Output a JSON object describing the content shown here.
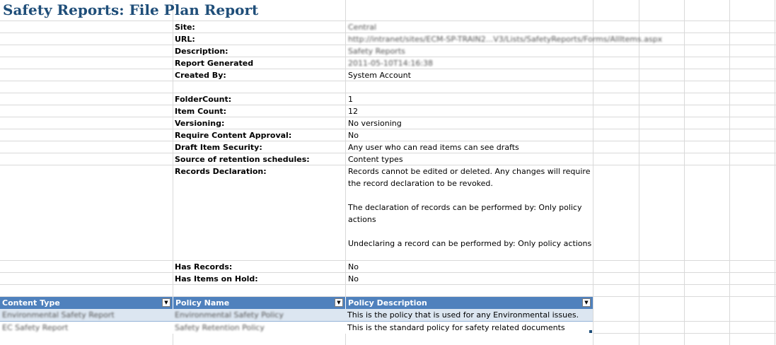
{
  "title": "Safety Reports: File Plan Report",
  "meta": [
    {
      "label": "Site:",
      "value": "Central",
      "redacted": true
    },
    {
      "label": "URL:",
      "value": "http://intranet/sites/ECM-SP-TRAIN2...V3/Lists/SafetyReports/Forms/AllItems.aspx",
      "redacted": true
    },
    {
      "label": "Description:",
      "value": "Safety Reports",
      "redacted": true
    },
    {
      "label": "Report Generated",
      "value": "2011-05-10T14:16:38",
      "redacted": true
    },
    {
      "label": "Created By:",
      "value": "System Account",
      "redacted": false
    }
  ],
  "settings": [
    {
      "label": "FolderCount:",
      "value": "1"
    },
    {
      "label": "Item Count:",
      "value": "12"
    },
    {
      "label": "Versioning:",
      "value": "No versioning"
    },
    {
      "label": "Require Content Approval:",
      "value": "No"
    },
    {
      "label": "Draft Item Security:",
      "value": "Any user who can read items can see drafts"
    },
    {
      "label": "Source of retention schedules:",
      "value": "Content types"
    }
  ],
  "records_declaration": {
    "label": "Records Declaration:",
    "paragraphs": [
      "Records cannot be edited or deleted.  Any changes will require the record declaration to be revoked.",
      "The declaration of records can be performed by: Only policy actions",
      "Undeclaring a record can be performed by: Only policy actions"
    ]
  },
  "records_status": [
    {
      "label": "Has Records:",
      "value": "No"
    },
    {
      "label": "Has Items on Hold:",
      "value": "No"
    }
  ],
  "policy_table": {
    "headers": [
      "Content Type",
      "Policy Name",
      "Policy Description"
    ],
    "filter_glyph": "▼",
    "rows": [
      {
        "content_type": "Environmental Safety Report",
        "policy_name": "Environmental Safety Policy",
        "policy_description": "This is the policy that is used for any Environmental issues."
      },
      {
        "content_type": "EC Safety Report",
        "policy_name": "Safety Retention Policy",
        "policy_description": "This is the standard policy for safety related documents"
      }
    ]
  },
  "colors": {
    "header_fill": "#4f81bd",
    "band_fill": "#dce6f1",
    "title_color": "#1f4e79",
    "gridline": "#d9d9d9"
  }
}
